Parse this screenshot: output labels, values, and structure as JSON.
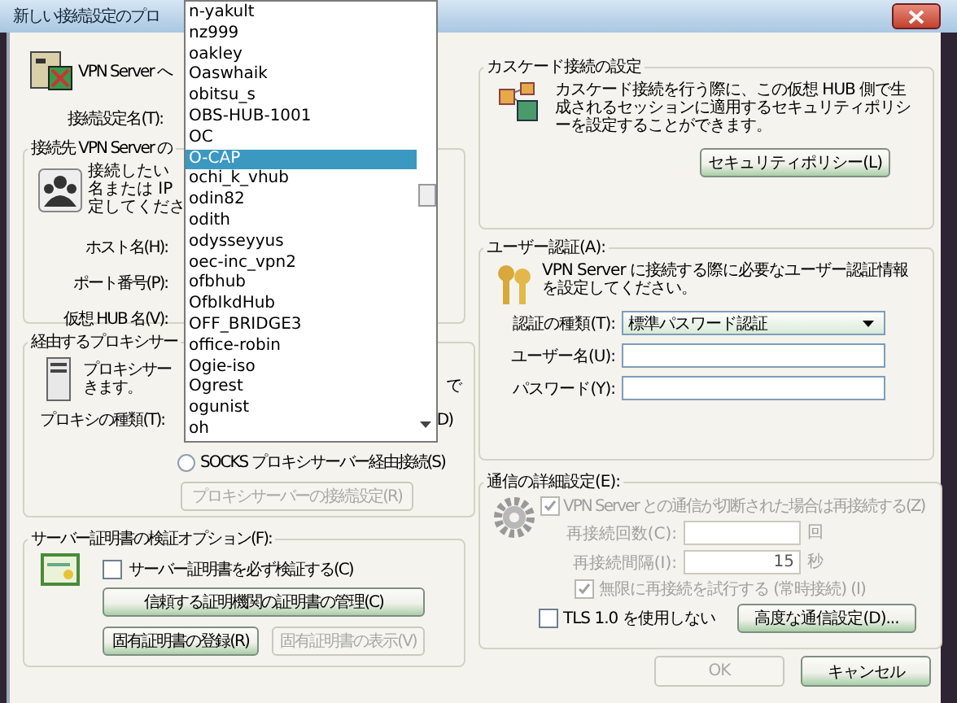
{
  "window": {
    "title": "新しい接続設定のプロ"
  },
  "left": {
    "intro": "VPN Server へ",
    "setting_name_label": "接続設定名(T):",
    "destination": {
      "legend": "接続先 VPN Server の",
      "lines": [
        "接続したい",
        "名または IP",
        "定してくださ"
      ],
      "fields": [
        "ホスト名(H):",
        "ポート番号(P):",
        "仮想 HUB 名(V):"
      ]
    },
    "proxy": {
      "legend": "経由するプロキシサー",
      "lines": [
        "プロキシサー",
        "きます。"
      ],
      "fragment_1": "で",
      "type_label": "プロキシの種類(T):",
      "fragment_2": "D)",
      "socks_option": {
        "label": "SOCKS プロキシサーバー経由接続(S)",
        "selected": false
      },
      "settings_button": {
        "label": "プロキシサーバーの接続設定(R)",
        "disabled": true
      }
    },
    "certificate": {
      "legend": "サーバー証明書の検証オプション(F):",
      "verify": {
        "label": "サーバー証明書を必ず検証する(C)",
        "checked": false
      },
      "buttons": [
        {
          "label": "信頼する証明機関の証明書の管理(C)",
          "disabled": false
        },
        {
          "label": "固有証明書の登録(R)",
          "disabled": false
        },
        {
          "label": "固有証明書の表示(V)",
          "disabled": true
        }
      ]
    }
  },
  "dropdown": {
    "items": [
      {
        "label": "n-yakult",
        "selected": false
      },
      {
        "label": "nz999",
        "selected": false
      },
      {
        "label": "oakley",
        "selected": false
      },
      {
        "label": "Oaswhaik",
        "selected": false
      },
      {
        "label": "obitsu_s",
        "selected": false
      },
      {
        "label": "OBS-HUB-1001",
        "selected": false
      },
      {
        "label": "OC",
        "selected": false
      },
      {
        "label": "O-CAP",
        "selected": true
      },
      {
        "label": "ochi_k_vhub",
        "selected": false
      },
      {
        "label": "odin82",
        "selected": false
      },
      {
        "label": "odith",
        "selected": false
      },
      {
        "label": "odysseyyus",
        "selected": false
      },
      {
        "label": "oec-inc_vpn2",
        "selected": false
      },
      {
        "label": "ofbhub",
        "selected": false
      },
      {
        "label": "OfbIkdHub",
        "selected": false
      },
      {
        "label": "OFF_BRIDGE3",
        "selected": false
      },
      {
        "label": "office-robin",
        "selected": false
      },
      {
        "label": "Ogie-iso",
        "selected": false
      },
      {
        "label": "Ogrest",
        "selected": false
      },
      {
        "label": "ogunist",
        "selected": false
      },
      {
        "label": "oh",
        "selected": false
      }
    ]
  },
  "cascade": {
    "legend": "カスケード接続の設定",
    "description": "カスケード接続を行う際に、この仮想 HUB 側で生成されるセッションに適用するセキュリティポリシーを設定することができます。",
    "button": {
      "label": "セキュリティポリシー(L)",
      "disabled": false
    }
  },
  "auth": {
    "legend": "ユーザー認証(A):",
    "description": "VPN Server に接続する際に必要なユーザー認証情報を設定してください。",
    "type_label": "認証の種類(T):",
    "type_value": "標準パスワード認証",
    "fields": [
      {
        "label": "ユーザー名(U):"
      },
      {
        "label": "パスワード(Y):"
      }
    ]
  },
  "advanced": {
    "legend": "通信の詳細設定(E):",
    "reconnect": {
      "label": "VPN Server との通信が切断された場合は再接続する(Z)",
      "checked": true,
      "disabled": true
    },
    "count": {
      "label": "再接続回数(C):",
      "unit": "回",
      "disabled": true
    },
    "interval": {
      "label": "再接続間隔(I):",
      "value": "15",
      "unit": "秒",
      "disabled": true
    },
    "infinite": {
      "label": "無限に再接続を試行する (常時接続) (I)",
      "checked": true,
      "disabled": true
    },
    "tls": {
      "label": "TLS 1.0 を使用しない",
      "checked": false
    },
    "button": {
      "label": "高度な通信設定(D)...",
      "disabled": false
    }
  },
  "footer": {
    "buttons": [
      {
        "label": "OK",
        "disabled": true
      },
      {
        "label": "キャンセル",
        "disabled": false
      }
    ]
  }
}
